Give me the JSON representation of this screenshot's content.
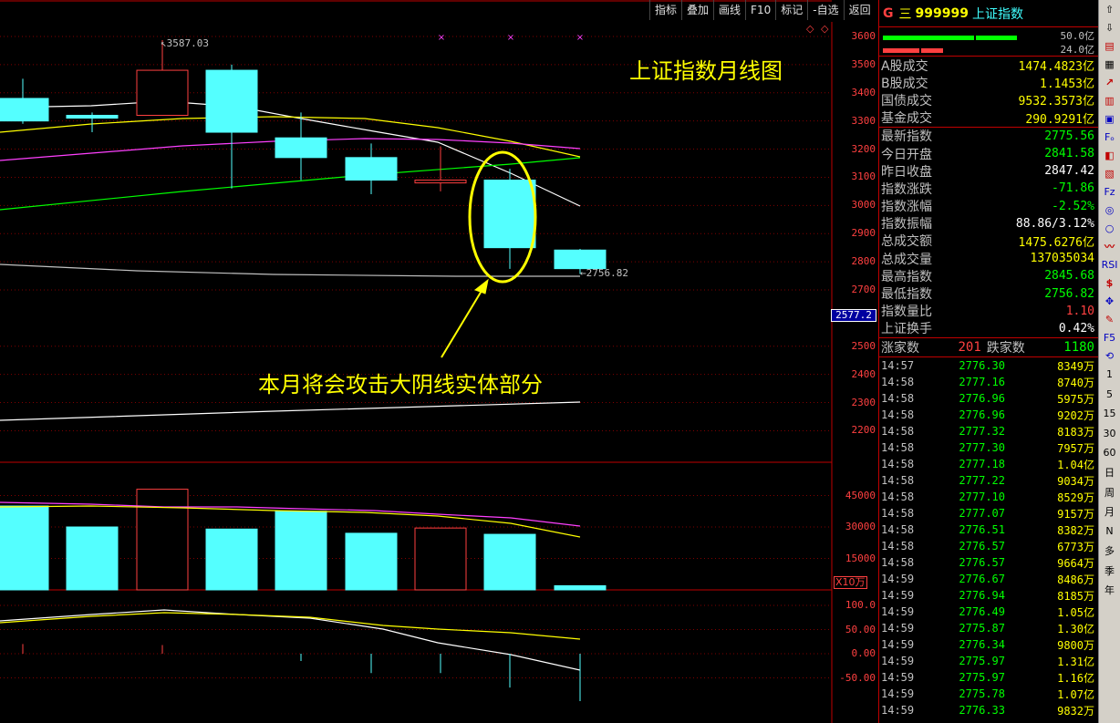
{
  "toolbar": [
    "指标",
    "叠加",
    "画线",
    "F10",
    "标记",
    "-自选",
    "返回"
  ],
  "chart": {
    "title": "上证指数月线图",
    "annotation": "本月将会攻击大阴线实体部分",
    "high_label": "3587.03",
    "low_label": "2756.82",
    "price_tag": "2577.2",
    "vol_unit": "X10万",
    "price_axis": [
      "3600",
      "3500",
      "3400",
      "3300",
      "3200",
      "3100",
      "3000",
      "2900",
      "2800",
      "2700",
      "2500",
      "2400",
      "2300",
      "2200"
    ],
    "vol_axis": [
      "45000",
      "30000",
      "15000"
    ],
    "macd_axis": [
      "100.0",
      "50.00",
      "0.00",
      "-50.00"
    ],
    "colors": {
      "up": "#ff4040",
      "down": "#54ffff",
      "bg": "#000000",
      "grid": "#c00000",
      "annotation": "#ffff00"
    }
  },
  "chart_data": {
    "type": "candlestick",
    "candles": [
      {
        "open": 3300,
        "close": 3380,
        "high": 3450,
        "low": 3290,
        "dir": "down"
      },
      {
        "open": 3320,
        "close": 3310,
        "high": 3330,
        "low": 3260,
        "dir": "down"
      },
      {
        "open": 3320,
        "close": 3480,
        "high": 3587.03,
        "low": 3320,
        "dir": "up"
      },
      {
        "open": 3480,
        "close": 3260,
        "high": 3500,
        "low": 3060,
        "dir": "down"
      },
      {
        "open": 3240,
        "close": 3170,
        "high": 3330,
        "low": 3090,
        "dir": "down"
      },
      {
        "open": 3170,
        "close": 3090,
        "high": 3220,
        "low": 3040,
        "dir": "down"
      },
      {
        "open": 3090,
        "close": 3080,
        "high": 3210,
        "low": 3050,
        "dir": "up"
      },
      {
        "open": 3090,
        "close": 2850,
        "high": 3130,
        "low": 2775,
        "dir": "down"
      },
      {
        "open": 2841.58,
        "close": 2775.56,
        "high": 2845.68,
        "low": 2756.82,
        "dir": "down"
      }
    ],
    "volume": [
      {
        "v": 40000,
        "dir": "down"
      },
      {
        "v": 30000,
        "dir": "down"
      },
      {
        "v": 48000,
        "dir": "up"
      },
      {
        "v": 29000,
        "dir": "down"
      },
      {
        "v": 37500,
        "dir": "down"
      },
      {
        "v": 27000,
        "dir": "down"
      },
      {
        "v": 29500,
        "dir": "up"
      },
      {
        "v": 26500,
        "dir": "down"
      },
      {
        "v": 2000,
        "dir": "down"
      }
    ],
    "macd": [
      20,
      0,
      18,
      0,
      -15,
      -40,
      -40,
      -70,
      -98
    ],
    "ylim": [
      2150,
      3650
    ]
  },
  "panel": {
    "g": "G",
    "eq": "三",
    "code": "999999",
    "name": "上证指数",
    "bar1": "50.0亿",
    "bar2": "24.0亿",
    "turnover": [
      {
        "k": "A股成交",
        "v": "1474.4823亿"
      },
      {
        "k": "B股成交",
        "v": "1.1453亿"
      },
      {
        "k": "国债成交",
        "v": "9532.3573亿"
      },
      {
        "k": "基金成交",
        "v": "290.9291亿"
      }
    ],
    "stats": [
      {
        "k": "最新指数",
        "v": "2775.56",
        "c": "#00ff00"
      },
      {
        "k": "今日开盘",
        "v": "2841.58",
        "c": "#00ff00"
      },
      {
        "k": "昨日收盘",
        "v": "2847.42",
        "c": "#ffffff"
      },
      {
        "k": "指数涨跌",
        "v": "-71.86",
        "c": "#00ff00"
      },
      {
        "k": "指数涨幅",
        "v": "-2.52%",
        "c": "#00ff00"
      },
      {
        "k": "指数振幅",
        "v": "88.86/3.12%",
        "c": "#ffffff"
      },
      {
        "k": "总成交额",
        "v": "1475.6276亿",
        "c": "#ffff00"
      },
      {
        "k": "总成交量",
        "v": "137035034",
        "c": "#ffff00"
      },
      {
        "k": "最高指数",
        "v": "2845.68",
        "c": "#00ff00"
      },
      {
        "k": "最低指数",
        "v": "2756.82",
        "c": "#00ff00"
      },
      {
        "k": "指数量比",
        "v": "1.10",
        "c": "#ff4040"
      },
      {
        "k": "上证换手",
        "v": "0.42%",
        "c": "#ffffff"
      }
    ],
    "adv_label": "涨家数",
    "adv_value": "201",
    "dec_label": "跌家数",
    "dec_value": "1180",
    "ticks": [
      {
        "t": "14:57",
        "p": "2776.30",
        "v": "8349万"
      },
      {
        "t": "14:58",
        "p": "2777.16",
        "v": "8740万"
      },
      {
        "t": "14:58",
        "p": "2776.96",
        "v": "5975万"
      },
      {
        "t": "14:58",
        "p": "2776.96",
        "v": "9202万"
      },
      {
        "t": "14:58",
        "p": "2777.32",
        "v": "8183万"
      },
      {
        "t": "14:58",
        "p": "2777.30",
        "v": "7957万"
      },
      {
        "t": "14:58",
        "p": "2777.18",
        "v": "1.04亿"
      },
      {
        "t": "14:58",
        "p": "2777.22",
        "v": "9034万"
      },
      {
        "t": "14:58",
        "p": "2777.10",
        "v": "8529万"
      },
      {
        "t": "14:58",
        "p": "2777.07",
        "v": "9157万"
      },
      {
        "t": "14:58",
        "p": "2776.51",
        "v": "8382万"
      },
      {
        "t": "14:58",
        "p": "2776.57",
        "v": "6773万"
      },
      {
        "t": "14:58",
        "p": "2776.57",
        "v": "9664万"
      },
      {
        "t": "14:59",
        "p": "2776.67",
        "v": "8486万"
      },
      {
        "t": "14:59",
        "p": "2776.94",
        "v": "8185万"
      },
      {
        "t": "14:59",
        "p": "2776.49",
        "v": "1.05亿"
      },
      {
        "t": "14:59",
        "p": "2775.87",
        "v": "1.30亿"
      },
      {
        "t": "14:59",
        "p": "2776.34",
        "v": "9800万"
      },
      {
        "t": "14:59",
        "p": "2775.97",
        "v": "1.31亿"
      },
      {
        "t": "14:59",
        "p": "2775.97",
        "v": "1.16亿"
      },
      {
        "t": "14:59",
        "p": "2775.78",
        "v": "1.07亿"
      },
      {
        "t": "14:59",
        "p": "2776.33",
        "v": "9832万"
      }
    ]
  },
  "sidebar": [
    "1",
    "5",
    "15",
    "30",
    "60",
    "日",
    "周",
    "月",
    "N",
    "多",
    "季",
    "年"
  ]
}
